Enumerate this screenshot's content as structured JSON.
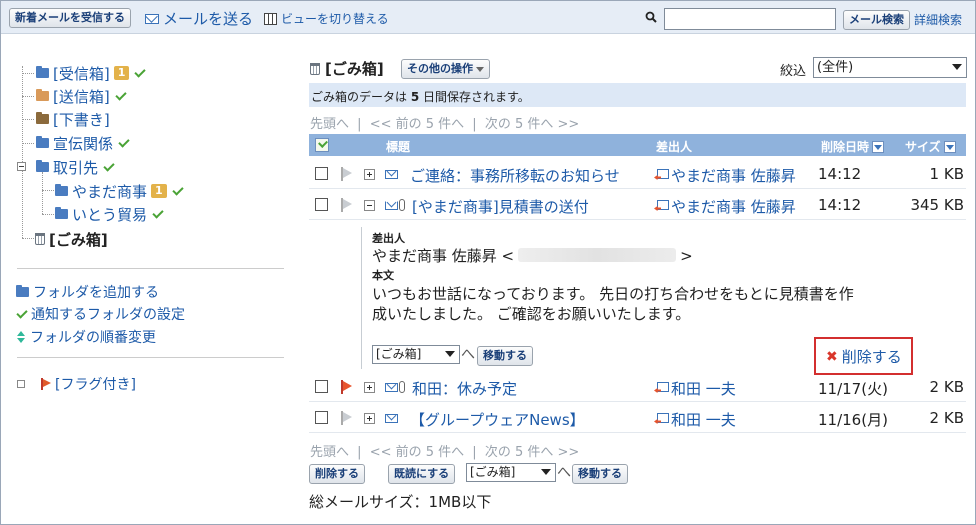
{
  "toolbar": {
    "receive_button": "新着メールを受信する",
    "send_link": "メールを送る",
    "view_switch_link": "ビューを切り替える",
    "search_value": "",
    "search_button": "メール検索",
    "advanced_search": "詳細検索"
  },
  "sidebar": {
    "folders": {
      "inbox": {
        "label": "[受信箱]",
        "badge": "1"
      },
      "sent": {
        "label": "[送信箱]"
      },
      "drafts": {
        "label": "[下書き]"
      },
      "advertising": {
        "label": "宣伝関係"
      },
      "clients": {
        "label": "取引先"
      },
      "yamada": {
        "label": "やまだ商事",
        "badge": "1"
      },
      "ito": {
        "label": "いとう貿易"
      },
      "trash": {
        "label": "[ごみ箱]"
      }
    },
    "add_folder": "フォルダを追加する",
    "notify_settings": "通知するフォルダの設定",
    "reorder": "フォルダの順番変更",
    "flagged": "[フラグ付き]"
  },
  "main": {
    "title": "[ごみ箱]",
    "other_ops_button": "その他の操作",
    "filter_label": "絞込",
    "filter_value": "(全件)",
    "info_pre": "ごみ箱のデータは ",
    "info_days": "5",
    "info_post": " 日間保存されます。",
    "pager": {
      "first": "先頭へ",
      "sep": "|",
      "prev": "<< 前の 5 件へ",
      "next": "次の 5 件へ >>"
    },
    "columns": {
      "subject": "標題",
      "sender": "差出人",
      "deleted_at": "削除日時",
      "size": "サイズ"
    },
    "rows": [
      {
        "subject": "ご連絡：事務所移転のお知らせ",
        "sender": "やまだ商事 佐藤昇",
        "date": "14:12",
        "size": "1 KB"
      },
      {
        "subject": "[やまだ商事]見積書の送付",
        "sender": "やまだ商事 佐藤昇",
        "date": "14:12",
        "size": "345 KB"
      },
      {
        "subject": "和田：休み予定",
        "sender": "和田 一夫",
        "date": "11/17(火)",
        "size": "2 KB"
      },
      {
        "subject": "【グループウェアNews】",
        "sender": "和田 一夫",
        "date": "11/16(月)",
        "size": "2 KB"
      }
    ],
    "preview": {
      "sender_label": "差出人",
      "sender_name": "やまだ商事 佐藤昇 <",
      "sender_close": ">",
      "body_label": "本文",
      "body_line1": "いつもお世話になっております。 先日の打ち合わせをもとに見積書を作",
      "body_line2": "成いたしました。 ご確認をお願いいたします。",
      "folder_select": "[ごみ箱]",
      "move_button": "移動する",
      "delete_link": "削除する"
    },
    "bottom": {
      "delete_button": "削除する",
      "mark_read_button": "既読にする",
      "folder_select": "[ごみ箱]",
      "move_button": "移動する",
      "total_size": "総メールサイズ：1MB以下"
    }
  },
  "colors": {
    "header_bg": "#e6edf6",
    "table_header": "#8fb2dc",
    "info_bar": "#dde8f6",
    "link": "#1d5aa8",
    "highlight_border": "#d32f2f"
  }
}
